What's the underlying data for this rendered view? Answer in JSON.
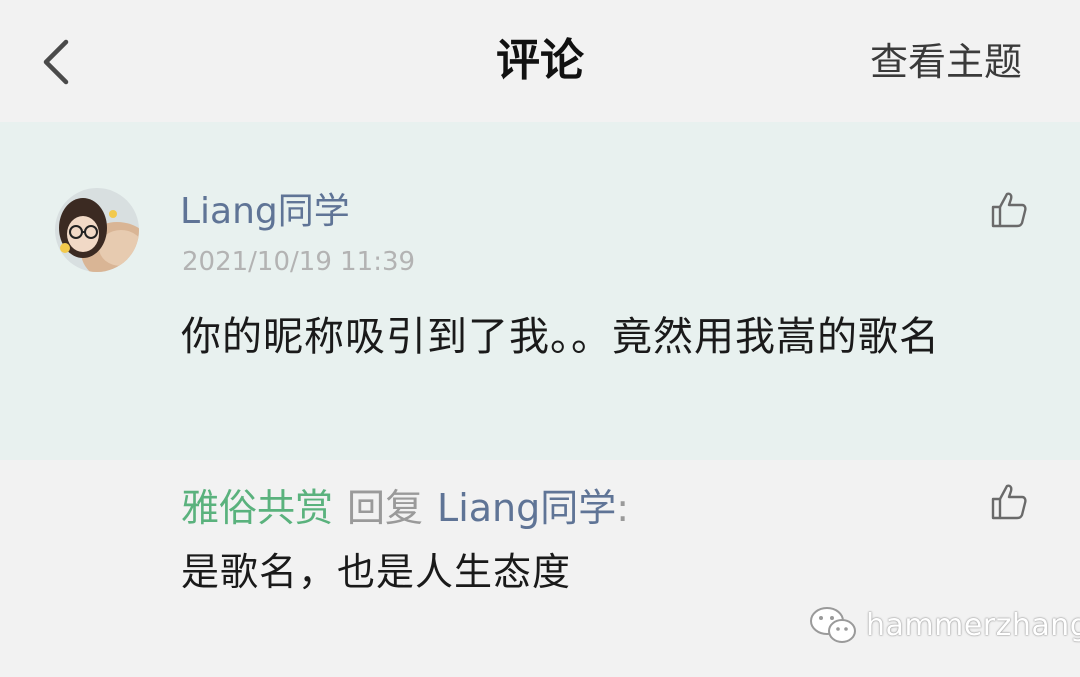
{
  "header": {
    "title": "评论",
    "view_topic_label": "查看主题",
    "back_icon": "chevron-left-icon"
  },
  "comment": {
    "author": "Liang同学",
    "timestamp": "2021/10/19 11:39",
    "text": "你的昵称吸引到了我。。竟然用我嵩的歌名",
    "like_icon": "thumbs-up-icon"
  },
  "reply": {
    "replier": "雅俗共赏",
    "reply_word": "回复",
    "target": "Liang同学",
    "colon": ":",
    "text": "是歌名，也是人生态度",
    "like_icon": "thumbs-up-icon"
  },
  "watermark": {
    "icon": "wechat-icon",
    "text": "hammerzhang"
  },
  "colors": {
    "background": "#f2f2f2",
    "highlight_background": "#e8f1ef",
    "author_name": "#5f7496",
    "replier_name": "#5ab27d",
    "muted": "#b3b3b3"
  }
}
